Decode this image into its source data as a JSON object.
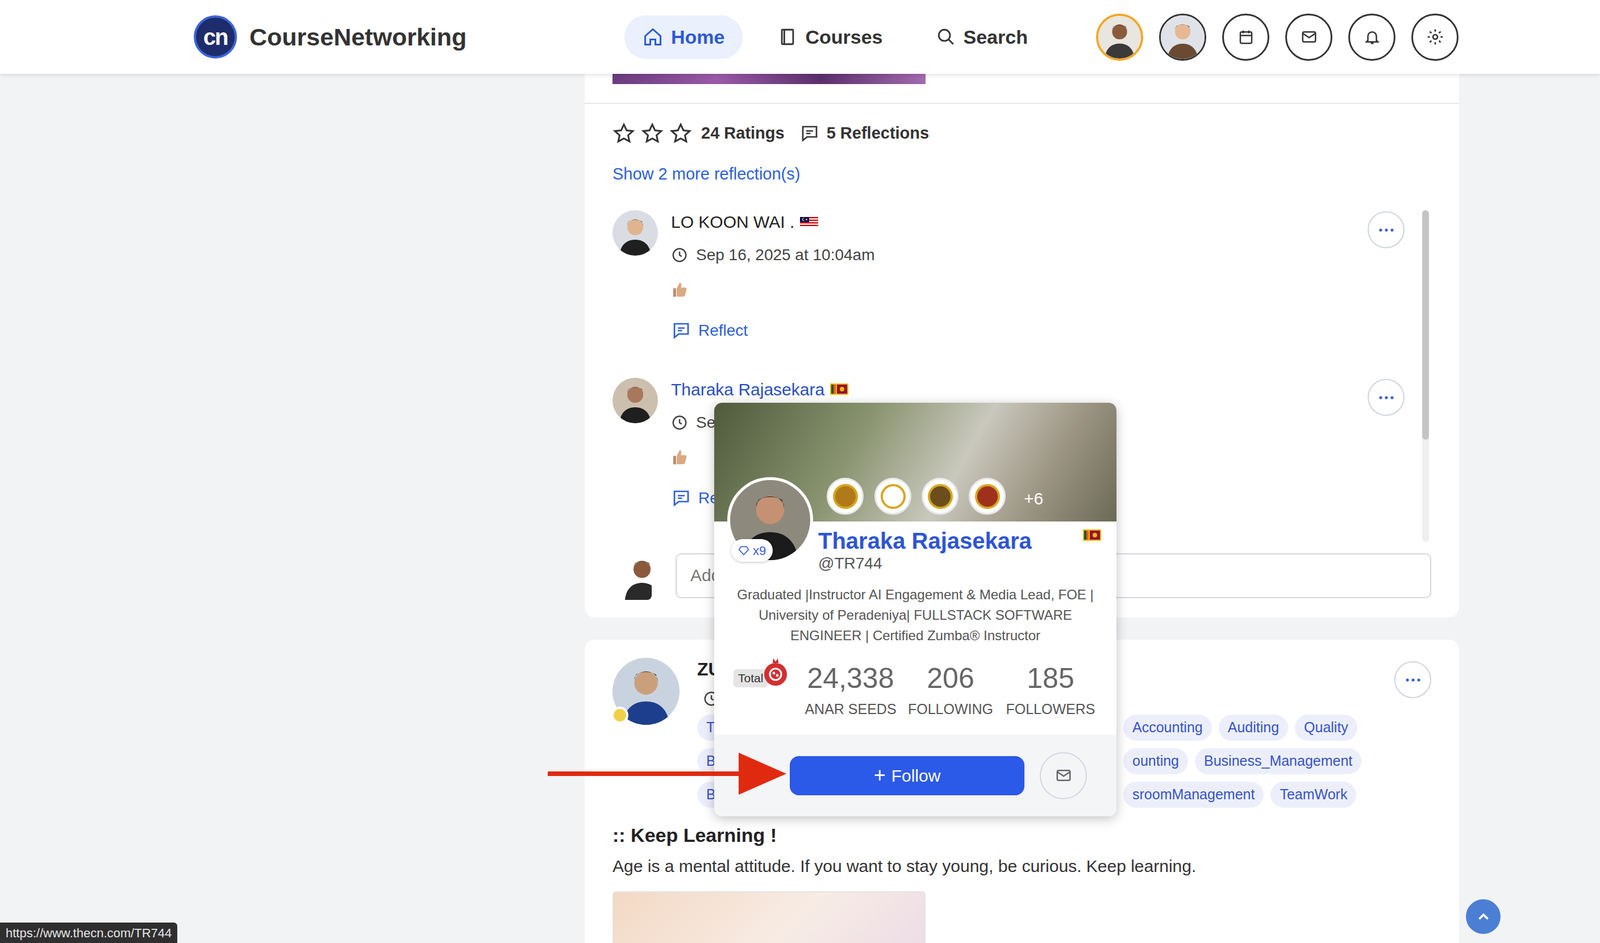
{
  "header": {
    "logo_text": "cn",
    "app_name": "CourseNetworking",
    "nav": [
      {
        "label": "Home",
        "selected": true
      },
      {
        "label": "Courses",
        "selected": false
      },
      {
        "label": "Search",
        "selected": false
      }
    ]
  },
  "post": {
    "stars": 0,
    "ratings_label": "24 Ratings",
    "reflections_label": "5 Reflections",
    "show_more": "Show 2 more reflection(s)",
    "reflections": [
      {
        "author": "LO KOON WAI .",
        "flag": "my",
        "hovered": false,
        "time": "Sep 16, 2025 at 10:04am",
        "action": "Reflect"
      },
      {
        "author": "Tharaka Rajasekara",
        "flag": "lk",
        "hovered": true,
        "time": "Se",
        "action": "Re"
      }
    ],
    "comment_placeholder": "Add"
  },
  "post2": {
    "author": "ZU",
    "online": true,
    "tag_rows": [
      [
        "T",
        "Accounting",
        "Auditing",
        "Quality"
      ],
      [
        "B",
        "ounting",
        "Business_Management"
      ],
      [
        "B",
        "sroomManagement",
        "TeamWork"
      ]
    ],
    "title": ":: Keep Learning !",
    "body": "Age is a mental attitude. If you want to stay young, be curious. Keep learning."
  },
  "profile_card": {
    "name": "Tharaka Rajasekara",
    "handle": "@TR744",
    "gem_count": "x9",
    "badges_more": "+6",
    "bio": "Graduated |Instructor AI Engagement & Media Lead, FOE | University of Peradeniya| FULLSTACK SOFTWARE ENGINEER | Certified Zumba® Instructor",
    "total_label": "Total",
    "stats": [
      {
        "value": "24,338",
        "label": "ANAR SEEDS"
      },
      {
        "value": "206",
        "label": "FOLLOWING"
      },
      {
        "value": "185",
        "label": "FOLLOWERS"
      }
    ],
    "follow_icon": "+",
    "follow_label": "Follow"
  },
  "status_url": "https://www.thecn.com/TR744"
}
